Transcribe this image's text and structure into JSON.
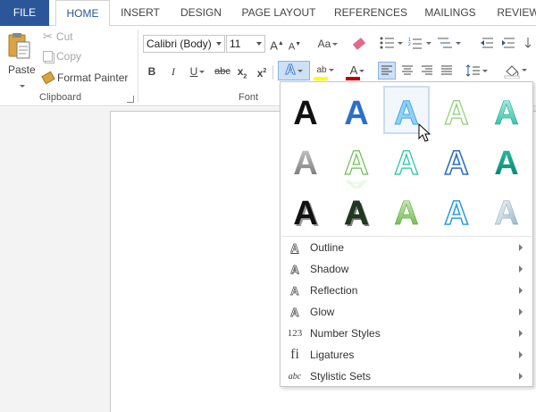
{
  "tabs": [
    "FILE",
    "HOME",
    "INSERT",
    "DESIGN",
    "PAGE LAYOUT",
    "REFERENCES",
    "MAILINGS",
    "REVIEW"
  ],
  "clipboard": {
    "paste_label": "Paste",
    "cut_label": "Cut",
    "copy_label": "Copy",
    "format_painter_label": "Format Painter",
    "group_label": "Clipboard"
  },
  "font": {
    "font_name": "Calibri (Body)",
    "font_size": "11",
    "group_label": "Font",
    "change_case_label": "Aa",
    "bold_label": "B",
    "italic_label": "I",
    "underline_label": "U",
    "strike_label": "abc",
    "subscript_label": "x",
    "superscript_label": "x",
    "grow_label": "A",
    "shrink_label": "A",
    "text_effects_label": "A",
    "font_color_label": "A",
    "highlight_label": "ab"
  },
  "colors": {
    "accent": "#2b579a",
    "font_color_bar": "#c00000",
    "highlight_bar": "#ffff00",
    "effects_blue": "#3d7bcf"
  },
  "text_effects_menu": {
    "gallery_glyph": "A",
    "items": [
      {
        "label": "Outline",
        "icon": "outline-a-icon"
      },
      {
        "label": "Shadow",
        "icon": "shadow-a-icon"
      },
      {
        "label": "Reflection",
        "icon": "reflection-a-icon"
      },
      {
        "label": "Glow",
        "icon": "glow-a-icon"
      },
      {
        "label": "Number Styles",
        "icon": "number-styles-icon"
      },
      {
        "label": "Ligatures",
        "icon": "ligatures-icon"
      },
      {
        "label": "Stylistic Sets",
        "icon": "stylistic-sets-icon"
      }
    ],
    "item_glyphs": [
      "A",
      "A",
      "A",
      "A",
      "123",
      "fi",
      "abc"
    ]
  }
}
